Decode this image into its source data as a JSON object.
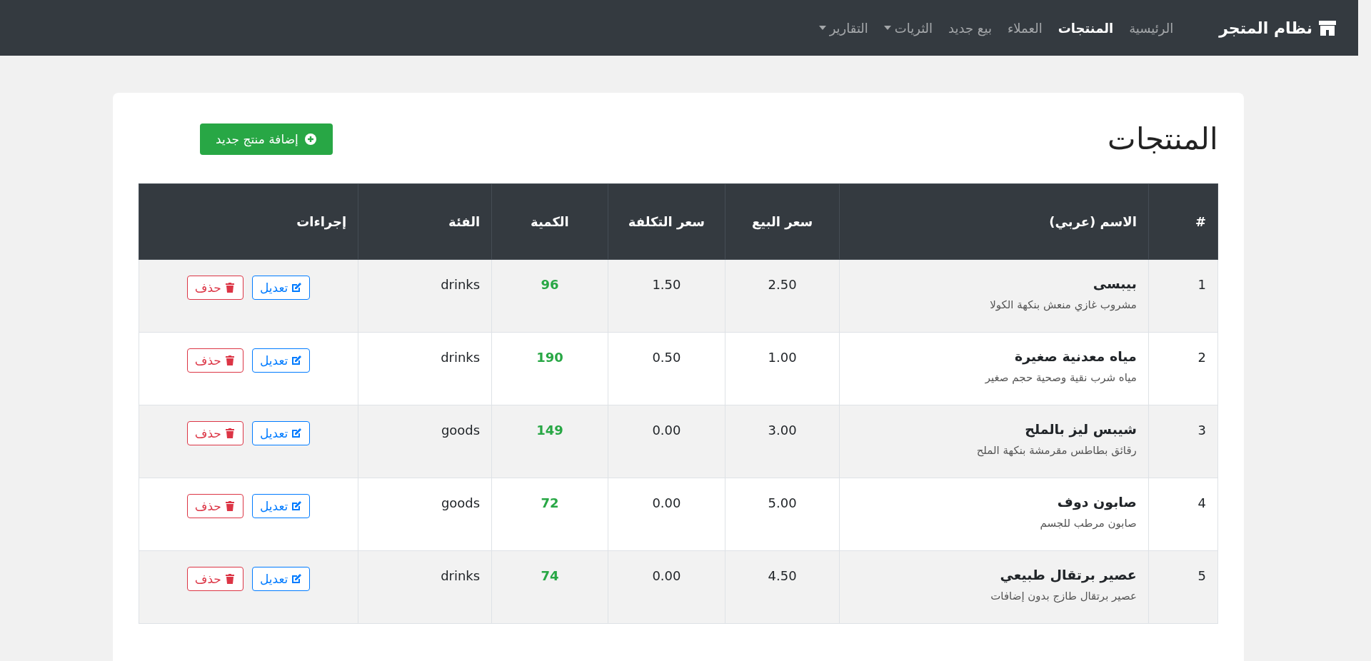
{
  "navbar": {
    "brand": "نظام المتجر",
    "links": [
      {
        "label": "الرئيسية",
        "selected": false,
        "dropdown": false
      },
      {
        "label": "المنتجات",
        "selected": true,
        "dropdown": false
      },
      {
        "label": "العملاء",
        "selected": false,
        "dropdown": false
      },
      {
        "label": "بيع جديد",
        "selected": false,
        "dropdown": false
      },
      {
        "label": "الثريات",
        "selected": false,
        "dropdown": true
      },
      {
        "label": "التقارير",
        "selected": false,
        "dropdown": true
      }
    ]
  },
  "page": {
    "title": "المنتجات",
    "add_button": "إضافة منتج جديد"
  },
  "table": {
    "columns": [
      "#",
      "الاسم (عربي)",
      "سعر البيع",
      "سعر التكلفة",
      "الكمية",
      "الفئة",
      "إجراءات"
    ],
    "rows": [
      {
        "index": "1",
        "name": "بيبسى",
        "description": "مشروب غازي منعش بنكهة الكولا",
        "sell_price": "2.50",
        "cost_price": "1.50",
        "quantity": "96",
        "category": "drinks",
        "edit": "تعديل",
        "delete": "حذف"
      },
      {
        "index": "2",
        "name": "مياه معدنية صغيرة",
        "description": "مياه شرب نقية وصحية حجم صغير",
        "sell_price": "1.00",
        "cost_price": "0.50",
        "quantity": "190",
        "category": "drinks",
        "edit": "تعديل",
        "delete": "حذف"
      },
      {
        "index": "3",
        "name": "شيبس ليز بالملح",
        "description": "رقائق بطاطس مقرمشة بنكهة الملح",
        "sell_price": "3.00",
        "cost_price": "0.00",
        "quantity": "149",
        "category": "goods",
        "edit": "تعديل",
        "delete": "حذف"
      },
      {
        "index": "4",
        "name": "صابون دوف",
        "description": "صابون مرطب للجسم",
        "sell_price": "5.00",
        "cost_price": "0.00",
        "quantity": "72",
        "category": "goods",
        "edit": "تعديل",
        "delete": "حذف"
      },
      {
        "index": "5",
        "name": "عصير برتقال طبيعي",
        "description": "عصير برتقال طازج بدون إضافات",
        "sell_price": "4.50",
        "cost_price": "0.00",
        "quantity": "74",
        "category": "drinks",
        "edit": "تعديل",
        "delete": "حذف"
      }
    ]
  }
}
